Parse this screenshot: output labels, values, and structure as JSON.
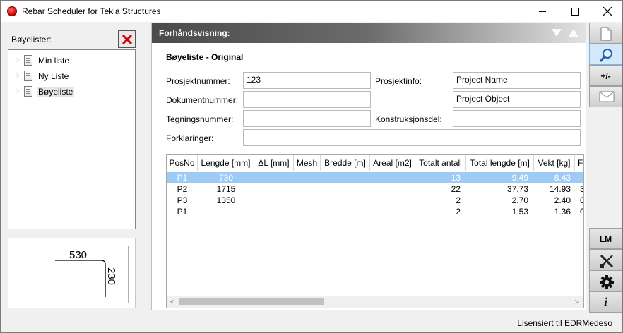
{
  "window": {
    "title": "Rebar Scheduler for Tekla Structures"
  },
  "left": {
    "lists_label": "Bøyelister:",
    "tree": [
      {
        "label": "Min liste",
        "selected": false
      },
      {
        "label": "Ny Liste",
        "selected": false
      },
      {
        "label": "Bøyeliste",
        "selected": true
      }
    ],
    "shape": {
      "dim_horizontal": "530",
      "dim_vertical": "230"
    }
  },
  "preview": {
    "header_title": "Forhåndsvisning:",
    "subtitle": "Bøyeliste - Original",
    "fields": {
      "prosjektnummer_label": "Prosjektnummer:",
      "prosjektnummer_value": "123",
      "prosjektinfo_label": "Prosjektinfo:",
      "prosjektinfo_value1": "Project Name",
      "prosjektinfo_value2": "Project Object",
      "dokumentnummer_label": "Dokumentnummer:",
      "dokumentnummer_value": "",
      "tegningsnummer_label": "Tegningsnummer:",
      "tegningsnummer_value": "",
      "konstruksjonsdel_label": "Konstruksjonsdel:",
      "konstruksjonsdel_value": "",
      "forklaringer_label": "Forklaringer:",
      "forklaringer_value": ""
    },
    "table": {
      "columns": [
        "PosNo",
        "Lengde [mm]",
        "ΔL [mm]",
        "Mesh",
        "Bredde [m]",
        "Areal [m2]",
        "Totalt antall",
        "Total lengde [m]",
        "Vekt [kg]",
        "Fo"
      ],
      "rows": [
        {
          "posno": "P1",
          "lengde": "730",
          "dl": "",
          "mesh": "",
          "bredde": "",
          "areal": "",
          "antall": "13",
          "total_lengde": "9.49",
          "vekt": "8.43",
          "fo": "",
          "selected": true
        },
        {
          "posno": "P2",
          "lengde": "1715",
          "dl": "",
          "mesh": "",
          "bredde": "",
          "areal": "",
          "antall": "22",
          "total_lengde": "37.73",
          "vekt": "14.93",
          "fo": "3",
          "selected": false
        },
        {
          "posno": "P3",
          "lengde": "1350",
          "dl": "",
          "mesh": "",
          "bredde": "",
          "areal": "",
          "antall": "2",
          "total_lengde": "2.70",
          "vekt": "2.40",
          "fo": "0",
          "selected": false
        },
        {
          "posno": "P1",
          "lengde": "",
          "dl": "",
          "mesh": "",
          "bredde": "",
          "areal": "",
          "antall": "2",
          "total_lengde": "1.53",
          "vekt": "1.36",
          "fo": "0",
          "selected": false
        }
      ],
      "scroll_left": "<",
      "scroll_right": ">"
    }
  },
  "toolbar": {
    "plusminus_label": "+/-",
    "lm_label": "LM",
    "info_label": "i"
  },
  "status": {
    "license_text": "Lisensiert til EDRMedeso"
  },
  "colors": {
    "selection_row": "#9ecbf5",
    "delete_red": "#d40000",
    "active_tool": "#d3e8fb"
  }
}
